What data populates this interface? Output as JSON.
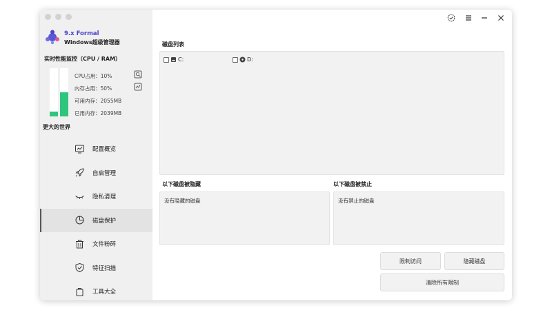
{
  "app": {
    "version": "9.x Formal",
    "name": "Windows超级管理器",
    "accent_color": "#4b46c8"
  },
  "monitor": {
    "title": "实时性能监控（CPU / RAM）",
    "cpu_usage": "CPU占用：10%",
    "mem_usage": "内存占用：50%",
    "available_mem": "可用内存：2055MB",
    "used_mem": "已用内存：2039MB",
    "cpu_percent": 10,
    "mem_percent": 50,
    "bar_color": "#2ec57d"
  },
  "world_label": "更大的世界",
  "nav": {
    "items": [
      {
        "label": "配置概览",
        "icon": "monitor-chart-icon"
      },
      {
        "label": "自启管理",
        "icon": "rocket-icon"
      },
      {
        "label": "隐私清理",
        "icon": "closed-eye-icon"
      },
      {
        "label": "磁盘保护",
        "icon": "pie-chart-icon",
        "active": true
      },
      {
        "label": "文件粉碎",
        "icon": "trash-icon"
      },
      {
        "label": "特征扫描",
        "icon": "shield-check-icon"
      },
      {
        "label": "工具大全",
        "icon": "bag-icon"
      }
    ]
  },
  "titlebar": {
    "icons": [
      "badge-check-icon",
      "menu-icon",
      "minimize-icon",
      "close-icon"
    ]
  },
  "disk_list": {
    "title": "磁盘列表",
    "disks": [
      {
        "label": "C:",
        "icon": "drive-icon"
      },
      {
        "label": "D:",
        "icon": "disc-icon"
      }
    ]
  },
  "hidden_disks": {
    "title": "以下磁盘被隐藏",
    "empty_text": "没有隐藏的磁盘"
  },
  "blocked_disks": {
    "title": "以下磁盘被禁止",
    "empty_text": "没有禁止的磁盘"
  },
  "buttons": {
    "restrict_access": "限制访问",
    "hide_disk": "隐藏磁盘",
    "clear_all": "清除所有限制"
  }
}
